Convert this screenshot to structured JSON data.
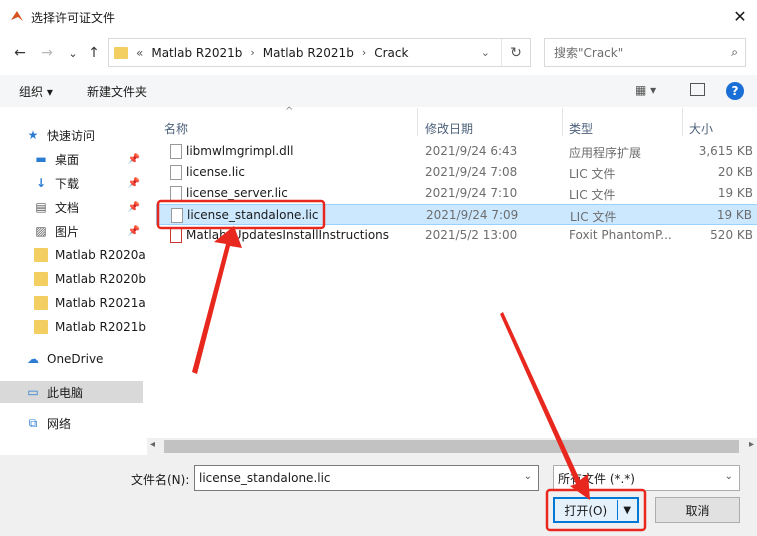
{
  "window": {
    "title": "选择许可证文件",
    "close_glyph": "✕"
  },
  "nav_buttons": {
    "back": "←",
    "forward": "→",
    "down": "⌄",
    "up": "↑"
  },
  "address": {
    "overflow": "«",
    "crumbs": [
      "Matlab R2021b",
      "Matlab R2021b",
      "Crack"
    ],
    "separator": "›",
    "dropdown": "⌄",
    "refresh_glyph": "↻"
  },
  "search": {
    "placeholder": "搜索\"Crack\"",
    "icon_glyph": "⌕"
  },
  "toolbar": {
    "organize": "组织 ▾",
    "new_folder": "新建文件夹",
    "view_glyph": "▦ ▾",
    "help_glyph": "?"
  },
  "sidebar": {
    "items": [
      {
        "label": "快速访问",
        "icon": "★"
      },
      {
        "label": "桌面",
        "icon": "▬",
        "pinned": true
      },
      {
        "label": "下载",
        "icon": "↓",
        "pinned": true
      },
      {
        "label": "文档",
        "icon": "▤",
        "pinned": true
      },
      {
        "label": "图片",
        "icon": "▨",
        "pinned": true
      },
      {
        "label": "Matlab R2020a"
      },
      {
        "label": "Matlab R2020b"
      },
      {
        "label": "Matlab R2021a"
      },
      {
        "label": "Matlab R2021b"
      },
      {
        "label": "OneDrive",
        "icon": "☁"
      },
      {
        "label": "此电脑",
        "icon": "▭"
      },
      {
        "label": "网络",
        "icon": "⧉"
      }
    ],
    "pin_glyph": "📌"
  },
  "columns": {
    "name": "名称",
    "date": "修改日期",
    "type": "类型",
    "size": "大小",
    "sort_glyph": "^"
  },
  "files": [
    {
      "name": "libmwlmgrimpl.dll",
      "date": "2021/9/24 6:43",
      "type": "应用程序扩展",
      "size": "3,615 KB"
    },
    {
      "name": "license.lic",
      "date": "2021/9/24 7:08",
      "type": "LIC 文件",
      "size": "20 KB"
    },
    {
      "name": "license_server.lic",
      "date": "2021/9/24 7:10",
      "type": "LIC 文件",
      "size": "19 KB"
    },
    {
      "name": "license_standalone.lic",
      "date": "2021/9/24 7:09",
      "type": "LIC 文件",
      "size": "19 KB"
    },
    {
      "name": "Matlab_UpdatesInstallInstructions",
      "date": "2021/5/2 13:00",
      "type": "Foxit PhantomP...",
      "size": "520 KB"
    }
  ],
  "scroll": {
    "left": "◂",
    "right": "▸"
  },
  "footer": {
    "filename_label": "文件名(N):",
    "filename_value": "license_standalone.lic",
    "filetype_value": "所有文件 (*.*)",
    "dropdown": "⌄",
    "open_label": "打开(O)",
    "open_arrow": "▼",
    "cancel_label": "取消"
  },
  "colors": {
    "annotation_red": "#e8281e",
    "selection_blue": "#cce8ff",
    "accent": "#0078d7"
  }
}
